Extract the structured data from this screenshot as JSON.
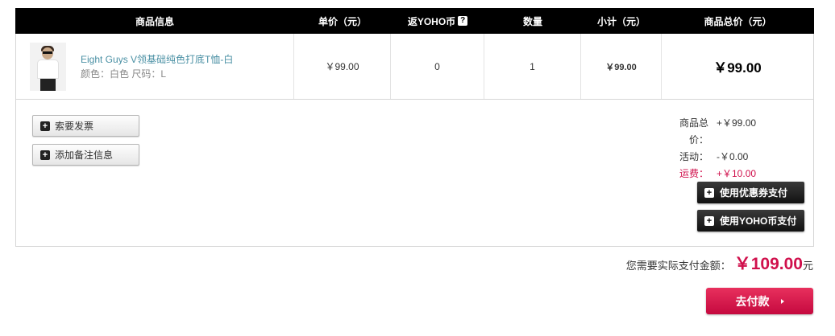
{
  "table": {
    "headers": {
      "product_info": "商品信息",
      "unit_price": "单价（元）",
      "yoho_coin": "返YOHO币",
      "quantity": "数量",
      "subtotal": "小计（元）",
      "total": "商品总价（元）"
    },
    "help_icon": "?",
    "item": {
      "name": "Eight Guys V领基础纯色打底T恤-白",
      "spec": "颜色：白色 尺码：L",
      "unit_price": "￥99.00",
      "yoho_coin": "0",
      "quantity": "1",
      "subtotal": "￥99.00",
      "total": "￥99.00"
    }
  },
  "actions": {
    "plus_icon": "+",
    "invoice": "索要发票",
    "add_note": "添加备注信息",
    "use_coupon": "使用优惠券支付",
    "use_yoho_coin": "使用YOHO币支付"
  },
  "summary": {
    "goods_total_label": "商品总价：",
    "goods_total_value": "+￥99.00",
    "activity_label": "活动：",
    "activity_value": "-￥0.00",
    "shipping_label": "运费：",
    "shipping_value": "+￥10.00"
  },
  "payment": {
    "label": "您需要实际支付金额：",
    "amount": "￥109.00",
    "unit": "元"
  },
  "checkout": {
    "label": "去付款"
  },
  "colors": {
    "accent": "#d0104c",
    "header_bg": "#000000",
    "link": "#4a90a4"
  }
}
